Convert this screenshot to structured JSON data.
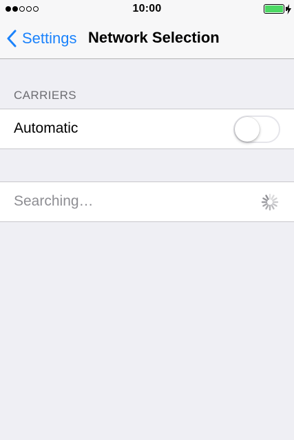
{
  "status_bar": {
    "time": "10:00",
    "signal_bars_filled": 2,
    "signal_bars_total": 5,
    "battery_level": 1.0,
    "charging": true,
    "battery_color": "#4cd964"
  },
  "nav_bar": {
    "back_label": "Settings",
    "title": "Network Selection",
    "accent_color": "#1a82fb"
  },
  "carriers_section": {
    "header": "CARRIERS",
    "automatic": {
      "label": "Automatic",
      "enabled": false
    }
  },
  "network_list": {
    "status_label": "Searching…",
    "spinner_icon": "activity-spinner-icon"
  }
}
